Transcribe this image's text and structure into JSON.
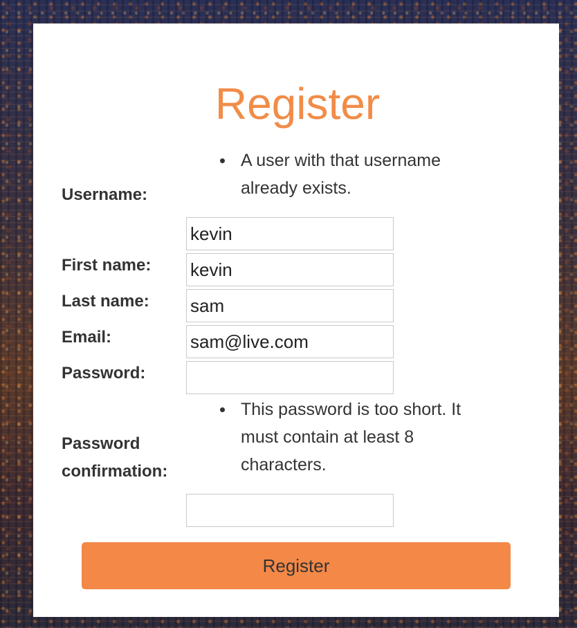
{
  "form": {
    "title": "Register",
    "username": {
      "label": "Username:",
      "errors": [
        "A user with that username",
        "already exists."
      ],
      "value": "kevin"
    },
    "first_name": {
      "label": "First name:",
      "value": "kevin"
    },
    "last_name": {
      "label": "Last name:",
      "value": "sam"
    },
    "email": {
      "label": "Email:",
      "value": "sam@live.com"
    },
    "password": {
      "label": "Password:",
      "value": ""
    },
    "password_confirmation": {
      "label_line1": "Password",
      "label_line2": "confirmation:",
      "errors": [
        "This password is too short. It",
        "must contain at least 8",
        "characters."
      ],
      "value": ""
    },
    "submit_label": "Register"
  },
  "colors": {
    "accent": "#f18c48",
    "button": "#f38847",
    "text": "#333333"
  }
}
